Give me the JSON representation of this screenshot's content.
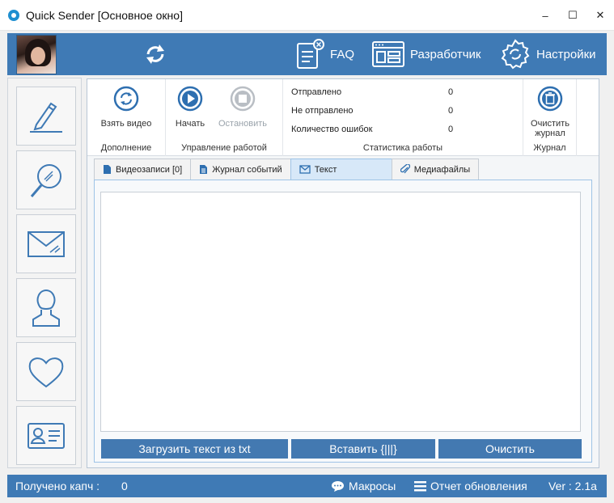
{
  "window": {
    "title": "Quick Sender [Основное окно]",
    "controls": {
      "minimize": "–",
      "maximize": "☐",
      "close": "✕"
    }
  },
  "header": {
    "buttons": [
      {
        "label": "FAQ",
        "icon": "faq-document-icon"
      },
      {
        "label": "Разработчик",
        "icon": "developer-window-icon"
      },
      {
        "label": "Настройки",
        "icon": "settings-gear-icon"
      }
    ]
  },
  "sidebar": {
    "items": [
      {
        "name": "edit",
        "icon": "pencil-write-icon"
      },
      {
        "name": "search",
        "icon": "magnifier-icon"
      },
      {
        "name": "mail",
        "icon": "envelope-icon"
      },
      {
        "name": "profile",
        "icon": "user-icon"
      },
      {
        "name": "favorites",
        "icon": "heart-icon"
      },
      {
        "name": "contact-card",
        "icon": "id-card-icon"
      }
    ]
  },
  "ribbon": {
    "groups": {
      "addon": "Дополнение",
      "control": "Управление работой",
      "stats": "Статистика работы",
      "log": "Журнал"
    },
    "buttons": {
      "take_video": "Взять видео",
      "start": "Начать",
      "stop": "Остановить",
      "clear_log": "Очистить журнал"
    },
    "stats": {
      "sent_label": "Отправлено",
      "sent_value": "0",
      "not_sent_label": "Не отправлено",
      "not_sent_value": "0",
      "errors_label": "Количество ошибок",
      "errors_value": "0"
    }
  },
  "tabs": [
    {
      "label": "Видеозаписи [0]",
      "icon": "document-icon",
      "active": false
    },
    {
      "label": "Журнал событий",
      "icon": "document-lines-icon",
      "active": false
    },
    {
      "label": "Текст",
      "icon": "envelope-icon",
      "active": true
    },
    {
      "label": "Медиафайлы",
      "icon": "paperclip-icon",
      "active": false
    }
  ],
  "editor": {
    "value": "",
    "buttons": {
      "load": "Загрузить текст из txt",
      "insert": "Вставить {|||}",
      "clear": "Очистить"
    }
  },
  "statusbar": {
    "captcha_label": "Получено капч :",
    "captcha_value": "0",
    "macros": "Макросы",
    "update_report": "Отчет обновления",
    "version": "Ver : 2.1a"
  },
  "colors": {
    "accent": "#3f7ab5",
    "button": "#4379b1",
    "tab_active": "#d7e8f8",
    "icon_blue": "#2e6fb0"
  }
}
